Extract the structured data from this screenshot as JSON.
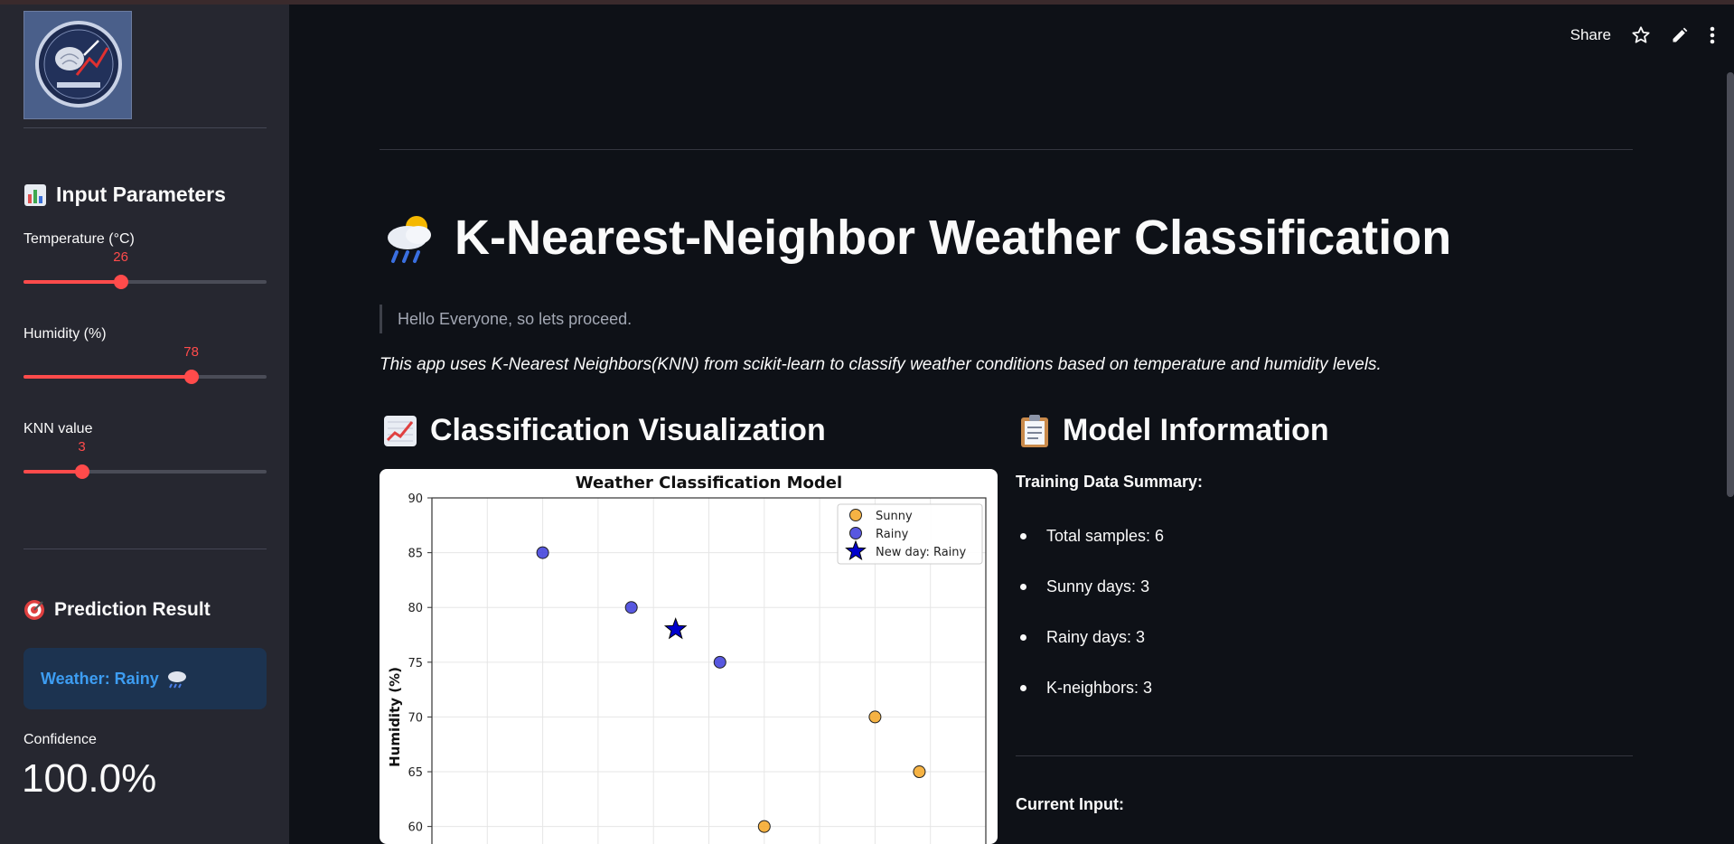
{
  "sidebar": {
    "input_heading": "Input Parameters",
    "sliders": [
      {
        "label": "Temperature (°C)",
        "value": "26",
        "fraction": 0.4
      },
      {
        "label": "Humidity (%)",
        "value": "78",
        "fraction": 0.69
      },
      {
        "label": "KNN value",
        "value": "3",
        "fraction": 0.24
      }
    ],
    "prediction_heading": "Prediction Result",
    "prediction_text": "Weather: Rainy",
    "confidence_label": "Confidence",
    "confidence_value": "100.0%"
  },
  "toolbar": {
    "share_label": "Share"
  },
  "main": {
    "title": "K-Nearest-Neighbor Weather Classification",
    "quote": "Hello Everyone, so lets proceed.",
    "description": "This app uses K-Nearest Neighbors(KNN) from scikit-learn to classify weather conditions based on temperature and humidity levels.",
    "viz_heading": "Classification Visualization",
    "info_heading": "Model Information",
    "training_summary_label": "Training Data Summary:",
    "training_items": [
      "Total samples: 6",
      "Sunny days: 3",
      "Rainy days: 3",
      "K-neighbors: 3"
    ],
    "current_input_label": "Current Input:"
  },
  "chart_data": {
    "type": "scatter",
    "title": "Weather Classification Model",
    "ylabel": "Humidity (%)",
    "xlabel": "",
    "ylim": [
      57,
      90
    ],
    "xlim": [
      10,
      35
    ],
    "yticks": [
      "90",
      "85",
      "80",
      "75",
      "70",
      "65",
      "60"
    ],
    "grid": true,
    "legend_position": "top-right",
    "series": [
      {
        "name": "Sunny",
        "color": "#f5a623",
        "points": [
          [
            30,
            70
          ],
          [
            32,
            65
          ],
          [
            25,
            60
          ]
        ]
      },
      {
        "name": "Rainy",
        "color": "#3b3bdb",
        "points": [
          [
            15,
            85
          ],
          [
            19,
            80
          ],
          [
            23,
            75
          ]
        ]
      },
      {
        "name": "New day:  Rainy",
        "color": "#0000cc",
        "marker": "star",
        "points": [
          [
            21,
            78
          ]
        ]
      }
    ]
  }
}
